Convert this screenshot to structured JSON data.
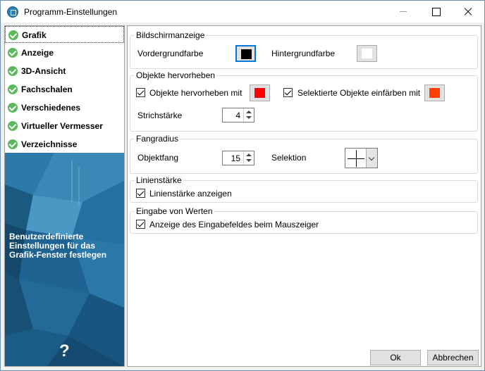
{
  "window": {
    "title": "Programm-Einstellungen"
  },
  "sidebar": {
    "items": [
      {
        "label": "Grafik"
      },
      {
        "label": "Anzeige"
      },
      {
        "label": "3D-Ansicht"
      },
      {
        "label": "Fachschalen"
      },
      {
        "label": "Verschiedenes"
      },
      {
        "label": "Virtueller Vermesser"
      },
      {
        "label": "Verzeichnisse"
      }
    ],
    "description": "Benutzerdefinierte Einstellungen für das Grafik-Fenster festlegen",
    "help_icon": "?"
  },
  "groups": {
    "bildschirm": {
      "title": "Bildschirmanzeige",
      "vordergrund_label": "Vordergrundfarbe",
      "vordergrund_color": "#000000",
      "hintergrund_label": "Hintergrundfarbe",
      "hintergrund_color": "#ffffff"
    },
    "objekte": {
      "title": "Objekte hervorheben",
      "hervorheben_label": "Objekte hervorheben mit",
      "hervorheben_checked": true,
      "hervorheben_color": "#ff0000",
      "einfaerben_label": "Selektierte Objekte einfärben mit",
      "einfaerben_checked": true,
      "einfaerben_color": "#ff4000",
      "strichstaerke_label": "Strichstärke",
      "strichstaerke_value": "4"
    },
    "fangradius": {
      "title": "Fangradius",
      "objektfang_label": "Objektfang",
      "objektfang_value": "15",
      "selektion_label": "Selektion",
      "selektion_icon": "crosshair-icon"
    },
    "linien": {
      "title": "Linienstärke",
      "anzeigen_label": "Linienstärke anzeigen",
      "anzeigen_checked": true
    },
    "eingabe": {
      "title": "Eingabe von Werten",
      "anzeige_label": "Anzeige des Eingabefeldes beim Mauszeiger",
      "anzeige_checked": true
    }
  },
  "buttons": {
    "ok": "Ok",
    "cancel": "Abbrechen"
  }
}
